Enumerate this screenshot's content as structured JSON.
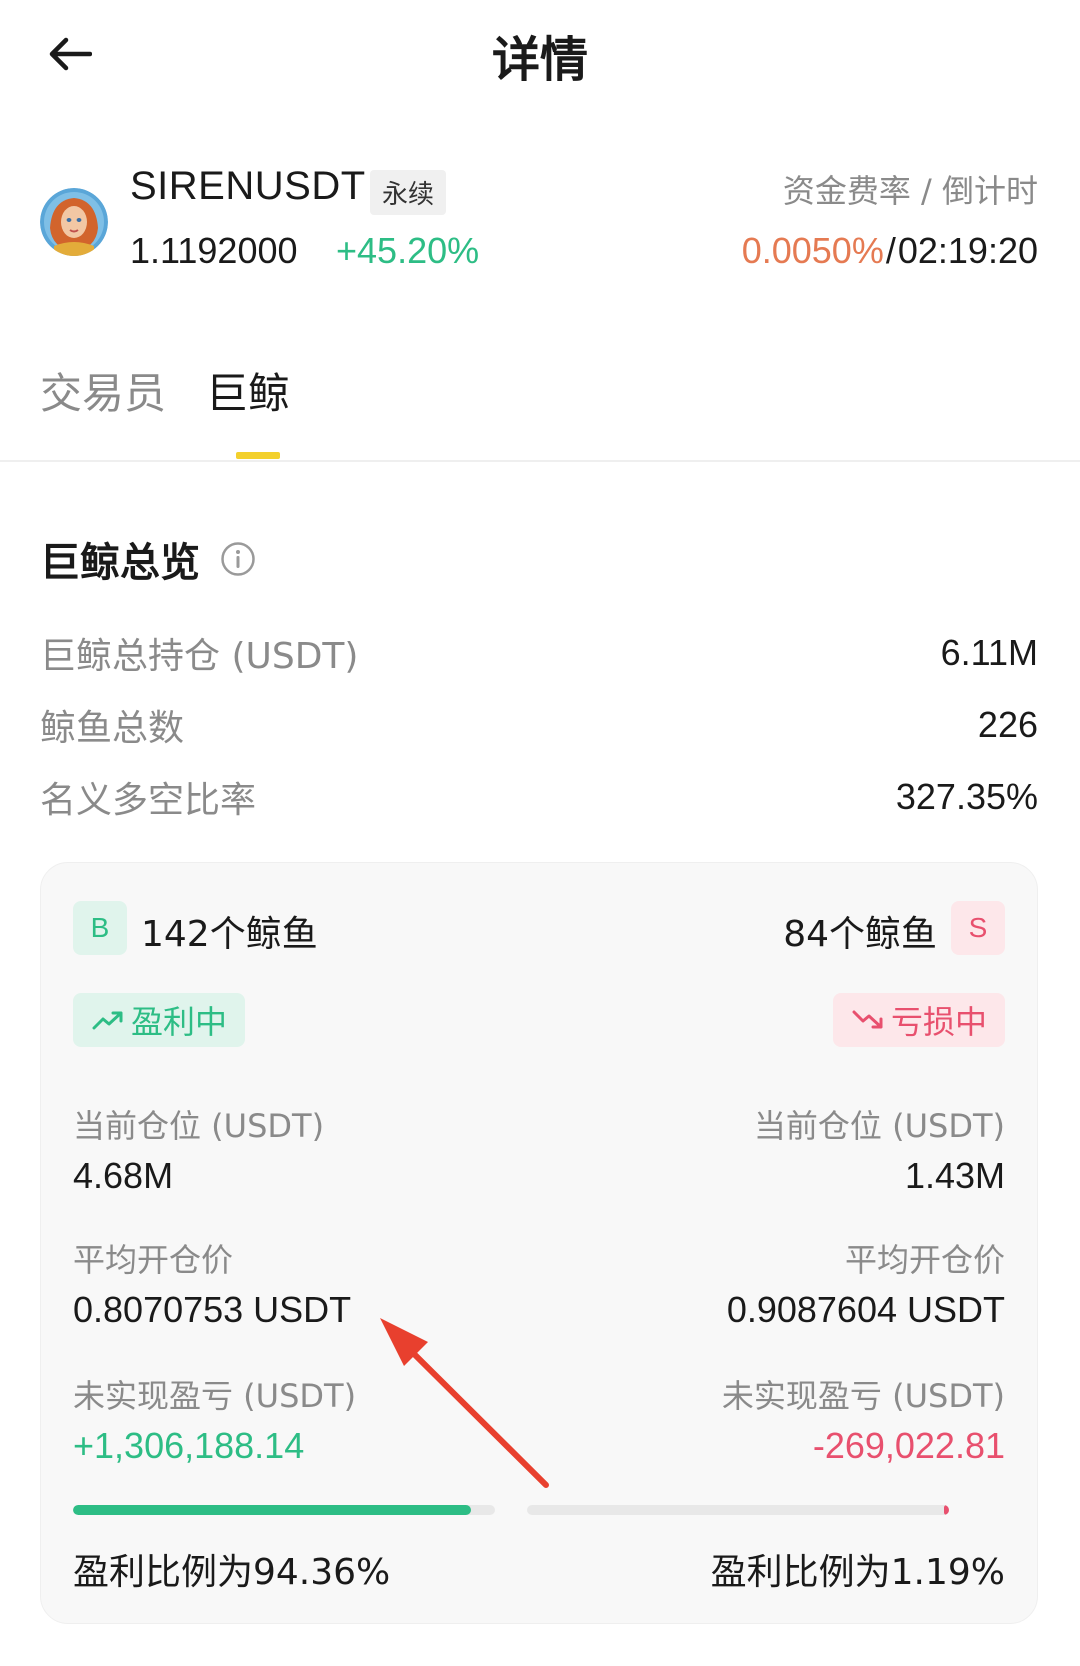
{
  "header": {
    "title": "详情",
    "back_icon": "back-arrow-icon"
  },
  "coin": {
    "symbol": "SIRENUSDT",
    "tag": "永续",
    "price": "1.1192000",
    "change": "+45.20%",
    "funding_label": "资金费率 / 倒计时",
    "funding_rate": "0.0050%",
    "funding_sep": "/",
    "countdown": "02:19:20",
    "avatar_icon": "siren-avatar-icon"
  },
  "tabs": [
    {
      "label": "交易员",
      "active": false
    },
    {
      "label": "巨鲸",
      "active": true
    }
  ],
  "overview": {
    "title": "巨鲸总览",
    "info_icon": "info-icon",
    "stats": [
      {
        "label": "巨鲸总持仓 (USDT)",
        "value": "6.11M"
      },
      {
        "label": "鲸鱼总数",
        "value": "226"
      },
      {
        "label": "名义多空比率",
        "value": "327.35%"
      }
    ]
  },
  "card": {
    "long": {
      "badge": "B",
      "count_label": "142个鲸鱼",
      "status": "盈利中",
      "position_label": "当前仓位 (USDT)",
      "position_value": "4.68M",
      "avg_price_label": "平均开仓价",
      "avg_price_value": "0.8070753 USDT",
      "pnl_label": "未实现盈亏 (USDT)",
      "pnl_value": "+1,306,188.14",
      "profit_ratio_pct": 94.36,
      "profit_ratio_text": "盈利比例为94.36%"
    },
    "short": {
      "badge": "S",
      "count_label": "84个鲸鱼",
      "status": "亏损中",
      "position_label": "当前仓位 (USDT)",
      "position_value": "1.43M",
      "avg_price_label": "平均开仓价",
      "avg_price_value": "0.9087604 USDT",
      "pnl_label": "未实现盈亏 (USDT)",
      "pnl_value": "-269,022.81",
      "profit_ratio_pct": 1.19,
      "profit_ratio_text": "盈利比例为1.19%"
    }
  },
  "colors": {
    "green": "#2dbd85",
    "red": "#e8506e",
    "orange": "#e57a52",
    "accent_yellow": "#f3d02c",
    "annotation_red": "#e8402e"
  }
}
